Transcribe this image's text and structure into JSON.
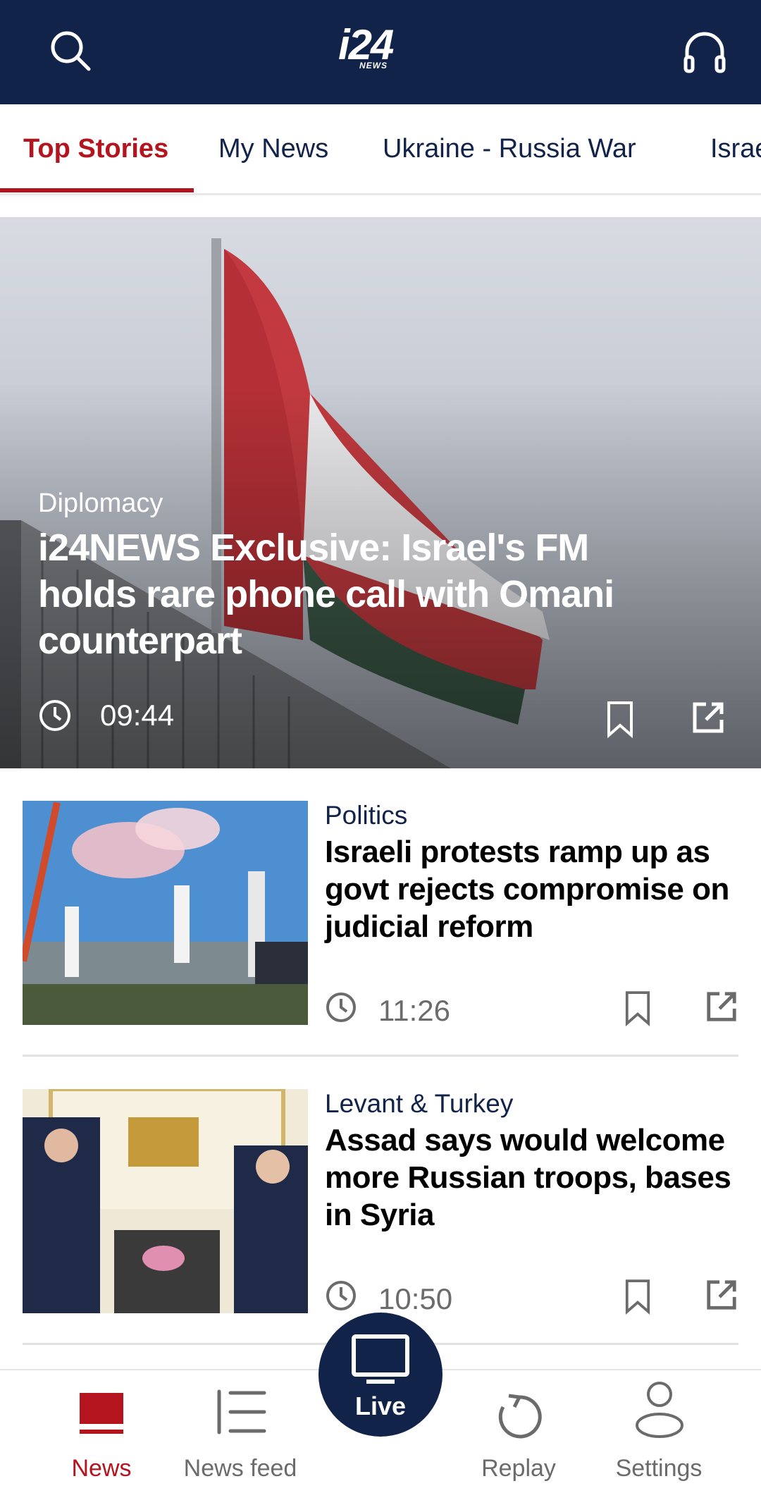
{
  "header": {
    "logo_text": "i24",
    "logo_sub": "NEWS"
  },
  "tabs": [
    {
      "label": "Top Stories",
      "active": true
    },
    {
      "label": "My News"
    },
    {
      "label": "Ukraine - Russia War"
    },
    {
      "label": "Israel"
    }
  ],
  "hero": {
    "category": "Diplomacy",
    "title": "i24NEWS Exclusive: Israel's FM holds rare phone call with Omani counterpart",
    "time": "09:44"
  },
  "articles": [
    {
      "category": "Politics",
      "title": "Israeli protests ramp up as govt rejects compromise on judicial reform",
      "time": "11:26"
    },
    {
      "category": "Levant & Turkey",
      "title": "Assad says would welcome more Russian troops, bases in Syria",
      "time": "10:50"
    }
  ],
  "bottom_nav": {
    "news": "News",
    "news_feed": "News feed",
    "live": "Live",
    "replay": "Replay",
    "settings": "Settings"
  },
  "colors": {
    "navy": "#12234a",
    "accent_red": "#b3141e"
  }
}
